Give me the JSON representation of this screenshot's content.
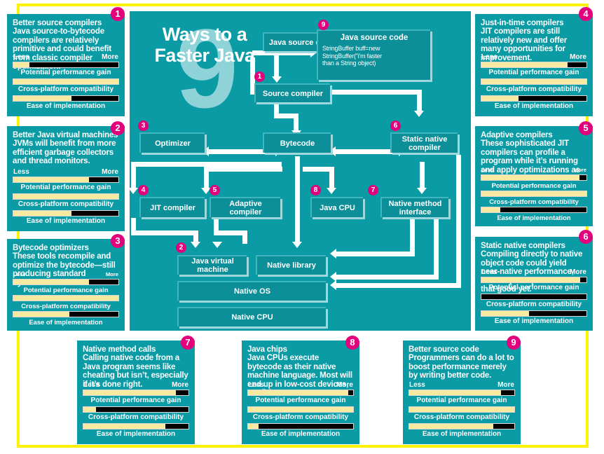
{
  "meta": {
    "headline_number": "9",
    "headline_text": "Ways to a Faster Java",
    "colors": {
      "teal": "#0a9ba5",
      "box_teal": "#0c8f99",
      "badge_magenta": "#e3007c",
      "frame_yellow": "#fff200",
      "bar_fill": "#f7e9a0",
      "bar_empty": "#000000"
    }
  },
  "meter_labels": {
    "less": "Less",
    "more": "More",
    "gain": "Potential performance gain",
    "compat": "Cross-platform compatibility",
    "ease": "Ease of implementation"
  },
  "panels": [
    {
      "number": "1",
      "title": "Better source compilers",
      "body": "Java source-to-bytecode compilers are relatively primitive and could benefit from classic compiler optimization.",
      "gain": 15,
      "compat": 100,
      "ease": 55
    },
    {
      "number": "2",
      "title": "Better Java virtual machines",
      "body": "JVMs will benefit from more efficient garbage collectors and thread monitors.",
      "gain": 72,
      "compat": 100,
      "ease": 55
    },
    {
      "number": "3",
      "title": "Bytecode optimizers",
      "body": "These tools recompile and optimize the bytecode—still producing standard bytecode.",
      "gain": 72,
      "compat": 100,
      "ease": 53
    },
    {
      "number": "4",
      "title": "Just-in-time compilers",
      "body": "JIT compilers are still relatively new and offer many opportunities for improvement.",
      "gain": 82,
      "compat": 100,
      "ease": 35
    },
    {
      "number": "5",
      "title": "Adaptive compilers",
      "body": "These sophisticated JIT compilers can profile a program while it’s running and apply optimizations as needed.",
      "gain": 93,
      "compat": 100,
      "ease": 18
    },
    {
      "number": "6",
      "title": "Static native compilers",
      "body": "Compiling directly to native object code could yield near-native performance, but early compilers aren’t that good yet.",
      "gain": 94,
      "compat": 0,
      "ease": 45
    },
    {
      "number": "7",
      "title": "Native method calls",
      "body": "Calling native code from a Java program seems like cheating but isn’t, especially if it’s done right.",
      "gain": 88,
      "compat": 12,
      "ease": 78
    },
    {
      "number": "8",
      "title": "Java chips",
      "body": "Java CPUs execute bytecode as their native machine language. Most will end up in low-cost devices, not PCs.",
      "gain": 95,
      "compat": 100,
      "ease": 10
    },
    {
      "number": "9",
      "title": "Better source code",
      "body": "Programmers can do a lot to boost performance merely by writing better code.",
      "gain": 87,
      "compat": 100,
      "ease": 80
    }
  ],
  "diagram": {
    "boxes": {
      "java_source_code": "Java source code",
      "source_compiler": "Source compiler",
      "optimizer": "Optimizer",
      "bytecode": "Bytecode",
      "static_native_compiler": "Static native compiler",
      "jit_compiler": "JIT compiler",
      "adaptive_compiler": "Adaptive compiler",
      "java_cpu": "Java CPU",
      "native_method_interface": "Native method interface",
      "java_virtual_machine": "Java virtual machine",
      "native_library": "Native library",
      "native_os": "Native OS",
      "native_cpu": "Native CPU"
    },
    "code_box": {
      "heading": "Java source code",
      "line1": "StringBuffer buff=new",
      "line2": "StringBuffer(\"i'm faster",
      "line3": "than a String object)"
    },
    "badges": {
      "b1": "1",
      "b2": "2",
      "b3": "3",
      "b4": "4",
      "b5": "5",
      "b6": "6",
      "b7": "7",
      "b8": "8",
      "b9": "9"
    }
  }
}
